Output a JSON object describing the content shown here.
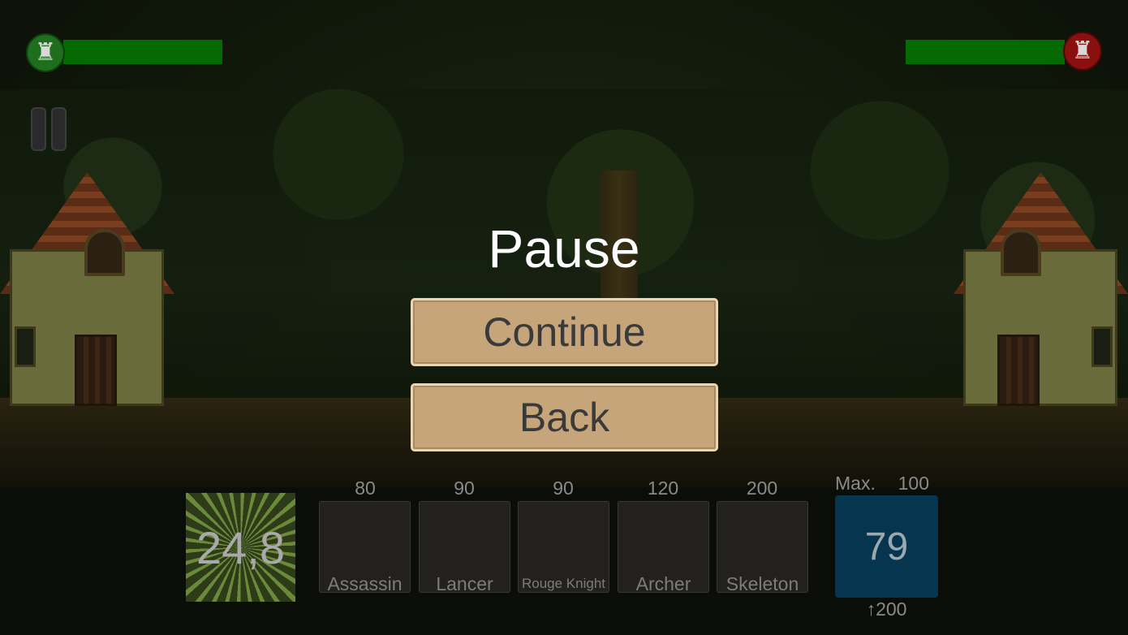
{
  "hud": {
    "player_tower_icon": "tower-icon",
    "player_color": "#1e6e1e",
    "enemy_tower_icon": "tower-icon",
    "enemy_color": "#8a1010",
    "player_health": 1.0,
    "enemy_health": 1.0,
    "health_bar_color": "#046a04",
    "pause_icon": "pause-icon"
  },
  "pause_menu": {
    "title": "Pause",
    "continue_label": "Continue",
    "back_label": "Back",
    "button_color": "#c6a57a"
  },
  "gold": {
    "value": "24,8"
  },
  "units": [
    {
      "name": "Assassin",
      "cost": "80"
    },
    {
      "name": "Lancer",
      "cost": "90"
    },
    {
      "name": "Rouge Knight",
      "cost": "90"
    },
    {
      "name": "Archer",
      "cost": "120"
    },
    {
      "name": "Skeleton",
      "cost": "200"
    }
  ],
  "upgrade": {
    "max_label": "Max.",
    "max_value": "100",
    "current": "79",
    "cost": "↑200",
    "color": "#06364f"
  }
}
